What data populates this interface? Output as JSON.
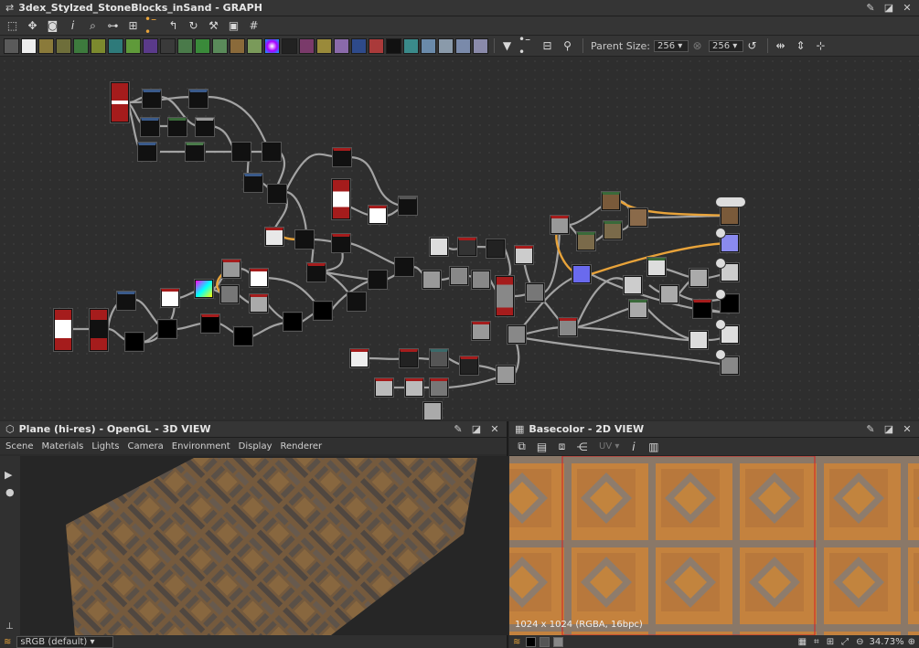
{
  "graph_panel": {
    "title": "3dex_Stylzed_StoneBlocks_inSand - GRAPH",
    "parent_size_label": "Parent Size:",
    "parent_size_value": "256",
    "parent_size_value2": "256"
  },
  "view3d": {
    "title": "Plane (hi-res) - OpenGL - 3D VIEW",
    "menu": [
      "Scene",
      "Materials",
      "Lights",
      "Camera",
      "Environment",
      "Display",
      "Renderer"
    ],
    "colorspace": "sRGB (default)"
  },
  "view2d": {
    "title": "Basecolor - 2D VIEW",
    "uv_label": "UV",
    "image_info": "1024 x 1024 (RGBA, 16bpc)",
    "zoom": "34.73%"
  },
  "colors": {
    "panel": "#353535",
    "graph_bg": "#2e2e2e",
    "link": "#b8b8b8",
    "link_highlight": "#e8a33a",
    "node_red": "#a51c1c",
    "node_dark": "#101010"
  },
  "icons": {
    "graph_toolbar_1": [
      "frame-icon",
      "pan-icon",
      "camera-icon",
      "info-icon",
      "search-icon",
      "link-icon",
      "layout-icon",
      "connector-icon",
      "curve-icon",
      "rotate-icon",
      "wrench-icon",
      "frame-select-icon",
      "grid-icon"
    ],
    "graph_toolbar_2_count": 28
  }
}
